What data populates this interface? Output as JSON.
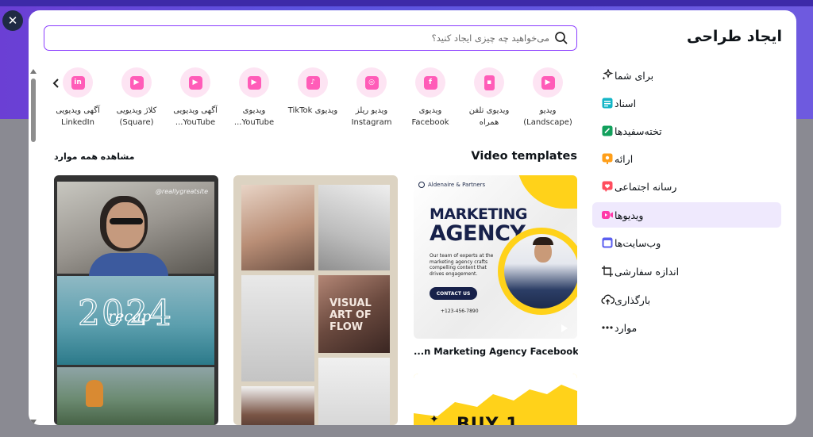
{
  "close_label": "✕",
  "sidebar": {
    "title": "ایجاد طراحی",
    "items": [
      {
        "label": "برای شما",
        "icon": "sparkle-icon"
      },
      {
        "label": "اسناد",
        "icon": "document-icon"
      },
      {
        "label": "تخته‌سفیدها",
        "icon": "whiteboard-icon"
      },
      {
        "label": "ارائه",
        "icon": "presentation-icon"
      },
      {
        "label": "رسانه اجتماعی",
        "icon": "heart-icon"
      },
      {
        "label": "ویدیوها",
        "icon": "video-icon",
        "active": true
      },
      {
        "label": "وب‌سایت‌ها",
        "icon": "website-icon"
      },
      {
        "label": "اندازه سفارشی",
        "icon": "crop-icon"
      },
      {
        "label": "بارگذاری",
        "icon": "upload-cloud-icon"
      },
      {
        "label": "موارد",
        "icon": "more-dots-icon"
      }
    ]
  },
  "search": {
    "placeholder": "می‌خواهید چه چیزی ایجاد کنید؟"
  },
  "categories": [
    {
      "line1": "ویدیو",
      "line2": "(Landscape)",
      "icon": "play-icon"
    },
    {
      "line1": "ویدیوی تلفن",
      "line2": "همراه",
      "icon": "phone-video-icon"
    },
    {
      "line1": "ویدیوی",
      "line2": "Facebook",
      "icon": "facebook-icon"
    },
    {
      "line1": "ویدیو ریلز",
      "line2": "Instagram",
      "icon": "instagram-icon"
    },
    {
      "line1": "ویدیوی TikTok",
      "line2": "",
      "icon": "tiktok-icon"
    },
    {
      "line1": "ویدیوی",
      "line2": "YouTube...",
      "icon": "youtube-icon"
    },
    {
      "line1": "آگهی ویدیویی",
      "line2": "YouTube...",
      "icon": "youtube-icon"
    },
    {
      "line1": "کلاژ ویدیویی",
      "line2": "(Square)",
      "icon": "play-icon"
    },
    {
      "line1": "آگهی ویدیویی",
      "line2": "LinkedIn",
      "icon": "linkedin-icon"
    }
  ],
  "section": {
    "title": "Video templates",
    "see_all": "مشاهده همه موارد"
  },
  "templates": {
    "marketing": {
      "brand": "Aldenaire & Partners",
      "headline1": "MARKETING",
      "headline2": "AGENCY",
      "body": "Our team of experts at the marketing agency crafts compelling content that drives engagement.",
      "cta": "CONTACT US",
      "phone": "+123-456-7890",
      "caption": "...n Marketing Agency Facebook Video"
    },
    "flow": {
      "line1": "VISUAL",
      "line2": "ART OF",
      "line3": "FLOW"
    },
    "recap": {
      "handle": "@reallygreatsite",
      "year": "2024",
      "word": "recap"
    },
    "buy": {
      "text": "BUY 1"
    }
  }
}
